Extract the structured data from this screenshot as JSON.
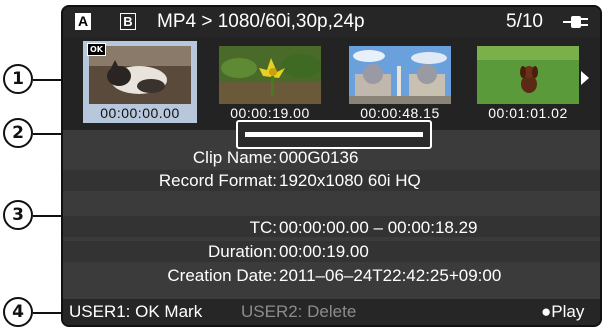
{
  "callouts": [
    "1",
    "2",
    "3",
    "4"
  ],
  "header": {
    "slot_a": "A",
    "slot_b": "B",
    "format": "MP4 > 1080/60i,30p,24p",
    "clip_count": "5/10"
  },
  "thumbnails": [
    {
      "timecode": "00:00:00.00",
      "selected": true,
      "ok": "OK",
      "scene": "cat"
    },
    {
      "timecode": "00:00:19.00",
      "selected": false,
      "scene": "flower"
    },
    {
      "timecode": "00:00:48.15",
      "selected": false,
      "scene": "building"
    },
    {
      "timecode": "00:01:01.02",
      "selected": false,
      "scene": "dog"
    }
  ],
  "scrollbar": {
    "position": 0.0
  },
  "clip_info": {
    "clip_name_label": "Clip Name:",
    "clip_name": "000G0136",
    "record_format_label": "Record Format:",
    "record_format": "1920x1080 60i HQ",
    "tc_label": "TC:",
    "tc": "00:00:00.00 – 00:00:18.29",
    "duration_label": "Duration:",
    "duration": "00:00:19.00",
    "creation_date_label": "Creation Date:",
    "creation_date": "2011–06–24T22:42:25+09:00"
  },
  "footer": {
    "user1": "USER1: OK Mark",
    "user2": "USER2: Delete",
    "play": "●Play"
  },
  "colors": {
    "screen_bg": "#3b3b3b",
    "bar_bg": "#262626",
    "selection": "#b8c8dc",
    "disabled_text": "#8c8c8c"
  }
}
